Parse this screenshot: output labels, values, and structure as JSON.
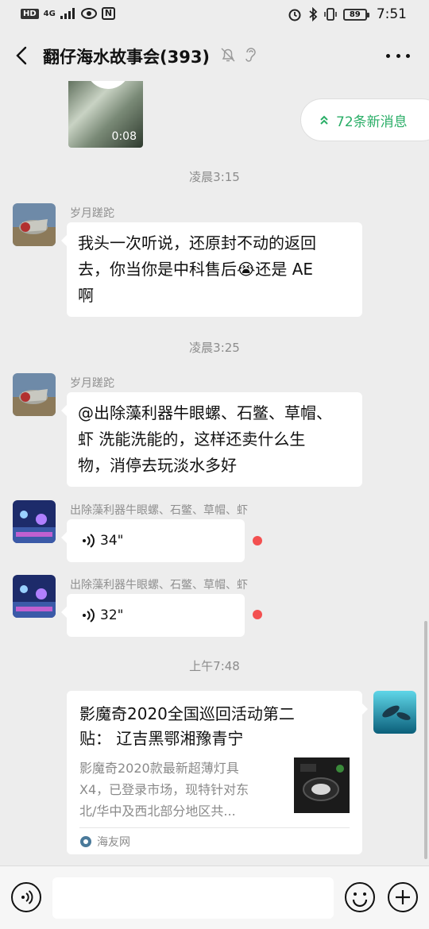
{
  "status_bar": {
    "hd_badge": "HD",
    "network": "4G",
    "nfc_badge": "N",
    "battery": "89",
    "time": "7:51"
  },
  "header": {
    "title": "翻仔海水故事会(393)"
  },
  "banner": {
    "new_messages": "72条新消息"
  },
  "messages": [
    {
      "type": "video",
      "duration": "0:08"
    },
    {
      "type": "time",
      "text": "凌晨3:15"
    },
    {
      "type": "text",
      "sender": "岁月蹉跎",
      "text_lines": [
        "我头一次听说，还原封不动的返回",
        "去，你当你是中科售后😭还是 AE",
        "啊"
      ]
    },
    {
      "type": "time",
      "text": "凌晨3:25"
    },
    {
      "type": "text",
      "sender": "岁月蹉跎",
      "text_lines": [
        "@出除藻利器牛眼螺、石鳖、草帽、",
        "虾  洗能洗能的，这样还卖什么生",
        "物，消停去玩淡水多好"
      ]
    },
    {
      "type": "voice",
      "sender": "出除藻利器牛眼螺、石鳖、草帽、虾",
      "duration": "34\""
    },
    {
      "type": "voice",
      "sender": "出除藻利器牛眼螺、石鳖、草帽、虾",
      "duration": "32\""
    },
    {
      "type": "time",
      "text": "上午7:48"
    },
    {
      "type": "link",
      "title_lines": [
        "影魔奇2020全国巡回活动第二",
        "贴： 辽吉黑鄂湘豫青宁"
      ],
      "desc_lines": [
        "影魔奇2020款最新超薄灯具",
        "X4，已登录市场，现特针对东",
        "北/华中及西北部分地区共..."
      ],
      "source": "海友网"
    }
  ],
  "colors": {
    "background": "#ededed",
    "bubble": "#ffffff",
    "accent_green": "#2aae67",
    "unread_dot": "#f35050"
  }
}
